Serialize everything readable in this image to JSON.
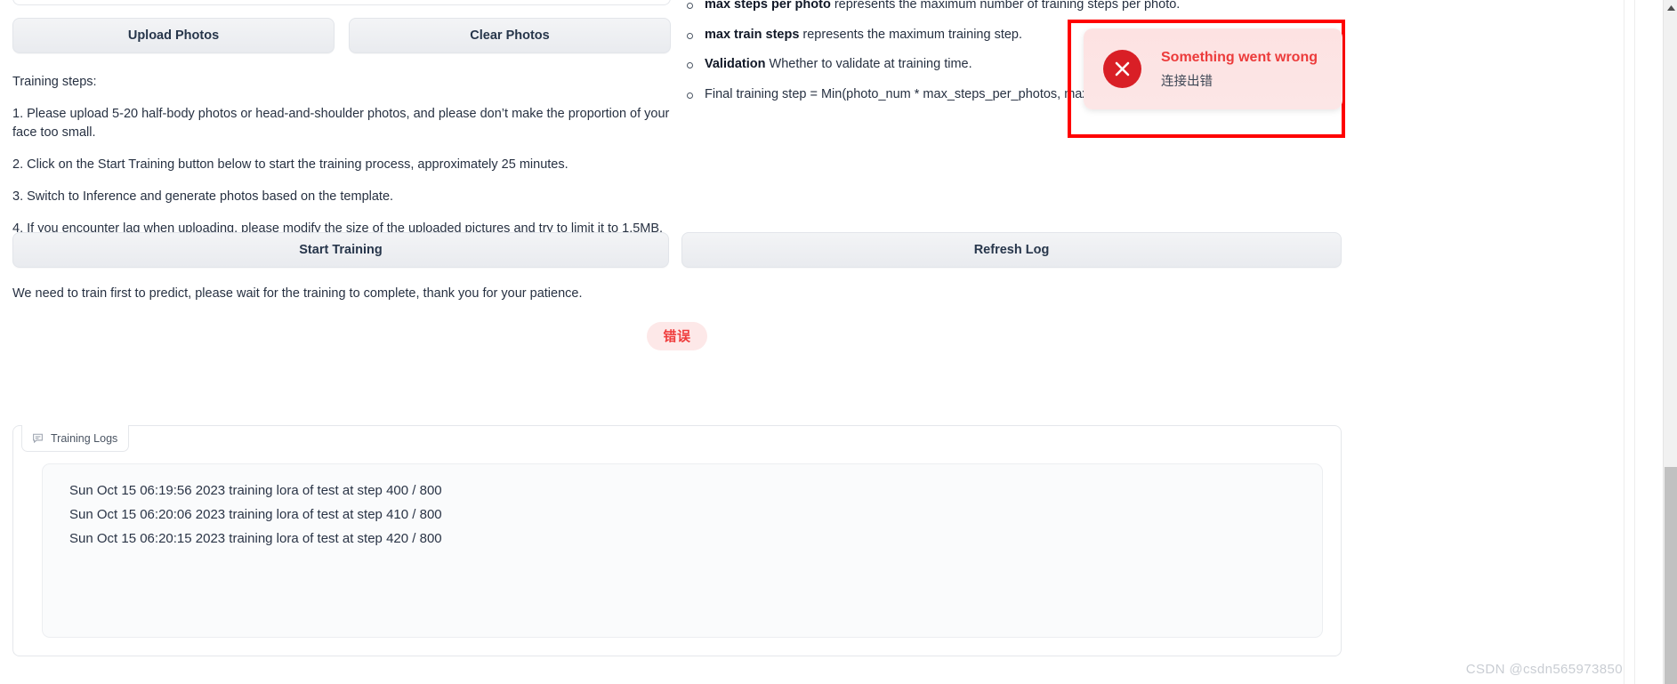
{
  "photo_buttons": {
    "upload": "Upload Photos",
    "clear": "Clear Photos"
  },
  "training_steps": {
    "heading": "Training steps:",
    "items": [
      "1. Please upload 5-20 half-body photos or head-and-shoulder photos, and please don’t make the proportion of your face too small.",
      "2. Click on the Start Training button below to start the training process, approximately 25 minutes.",
      "3. Switch to Inference and generate photos based on the template.",
      "4. If you encounter lag when uploading, please modify the size of the uploaded pictures and try to limit it to 1.5MB."
    ]
  },
  "parameter_help": {
    "items": [
      {
        "term": "max steps per photo",
        "rest": " represents the maximum number of training steps per photo."
      },
      {
        "term": "max train steps",
        "rest": " represents the maximum training step."
      },
      {
        "term": "Validation",
        "rest": " Whether to validate at training time."
      },
      {
        "term": "",
        "rest": "Final training step = Min(photo_num * max_steps_per_photos, max_tra"
      }
    ]
  },
  "actions": {
    "start_training": "Start Training",
    "refresh_log": "Refresh Log"
  },
  "status_note": "We need to train first to predict, please wait for the training to complete, thank you for your patience.",
  "status_badge": {
    "label": "错误",
    "text_color": "#ef3b3b",
    "background_color": "#fde8e8"
  },
  "error_toast": {
    "title": "Something went wrong",
    "message": "连接出错",
    "icon": "error-x-circle-icon",
    "icon_color": "#d91f26",
    "title_color": "#ec3b3b",
    "background_color": "#fde2e2",
    "highlight_border_color": "#ff0000"
  },
  "logs": {
    "tab_label": "Training Logs",
    "tab_icon": "note-bubble-icon",
    "lines": [
      "Sun Oct 15 06:19:56 2023 training lora of test at step 400 / 800",
      "Sun Oct 15 06:20:06 2023 training lora of test at step 410 / 800",
      "Sun Oct 15 06:20:15 2023 training lora of test at step 420 / 800"
    ]
  },
  "watermark": "CSDN @csdn565973850"
}
